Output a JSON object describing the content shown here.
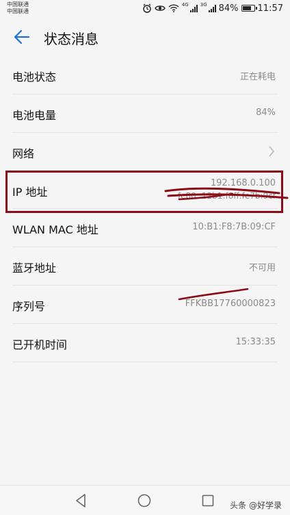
{
  "status_bar": {
    "carrier_line1": "中国联通",
    "carrier_line2": "中国联通",
    "net1": "4G",
    "net2": "3G",
    "battery": "84%",
    "battery_level": 0.84,
    "time": "11:57"
  },
  "app_bar": {
    "title": "状态消息"
  },
  "rows": {
    "battery_status": {
      "label": "电池状态",
      "value": "正在耗电"
    },
    "battery_level": {
      "label": "电池电量",
      "value": "84%"
    },
    "network": {
      "label": "网络"
    },
    "ip": {
      "label": "IP 地址",
      "value1": "192.168.0.100",
      "value2": "fe80::12b1:f8ff:fe7b:9cf"
    },
    "wlan_mac": {
      "label": "WLAN MAC 地址",
      "value": "10:B1:F8:7B:09:CF"
    },
    "bluetooth": {
      "label": "蓝牙地址",
      "value": "不可用"
    },
    "serial": {
      "label": "序列号",
      "value": "FFKBB17760000823"
    },
    "uptime": {
      "label": "已开机时间",
      "value": "15:33:35"
    }
  },
  "watermark": "头条 @好学录",
  "colors": {
    "accent": "#1f6fd1",
    "annotation": "#8b0c16"
  }
}
